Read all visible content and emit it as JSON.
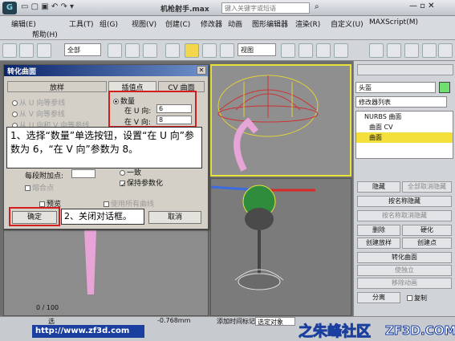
{
  "window": {
    "title": "机枪射手.max",
    "search_placeholder": "键入关键字或短语",
    "logo": "G"
  },
  "menu": [
    "编辑(E)",
    "工具(T)",
    "组(G)",
    "视图(V)",
    "创建(C)",
    "修改器",
    "动画",
    "图形编辑器",
    "渲染(R)",
    "自定义(U)",
    "MAXScript(M)",
    "帮助(H)"
  ],
  "toolbar": {
    "filter": "全部",
    "view": "视图"
  },
  "dialog": {
    "title": "转化曲面",
    "group_left": "放样",
    "group_mid": "插值点",
    "group_right": "CV 曲面",
    "radio_u": "从 U 向等参线",
    "radio_v": "从 V 向等参线",
    "radio_uv": "从 U 向和 V 向等参线",
    "count_label": "数量",
    "u_label": "在 U 向:",
    "u_value": "6",
    "v_label": "在 V 向:",
    "v_value": "8",
    "per_seg_label": "每段附加点:",
    "seal_label": "熔合点",
    "one_label": "一致",
    "keep_param_label": "保持参数化",
    "preview_label": "预览",
    "use_all_label": "使用所有曲线",
    "ok_label": "确定",
    "cancel_label": "取消"
  },
  "callouts": {
    "step1": "1、选择“数量”单选按钮，设置“在 U 向”参数为 6，“在 V 向”参数为 8。",
    "step2": "2、关闭对话框。"
  },
  "viewport": {
    "label_left": "0 / 100"
  },
  "command_panel": {
    "object_name": "头盔",
    "modifier_list": "修改器列表",
    "stack": [
      "NURBS 曲面",
      "曲面 CV",
      "曲面"
    ],
    "buttons": [
      "隐藏",
      "全部取消隐藏",
      "按名称隐藏",
      "按名称取消隐藏",
      "删除",
      "硬化",
      "创建放样",
      "创建点",
      "转化曲面",
      "使独立",
      "移除动画",
      "分离",
      "复制"
    ]
  },
  "status": {
    "select": "选",
    "selected": "选定对象",
    "add_time": "添加时间标记",
    "coord": "-0.768mm"
  },
  "watermark": {
    "url": "http://www.zf3d.com",
    "brand": "之朱峰社区",
    "site": "ZF3D.COM"
  }
}
